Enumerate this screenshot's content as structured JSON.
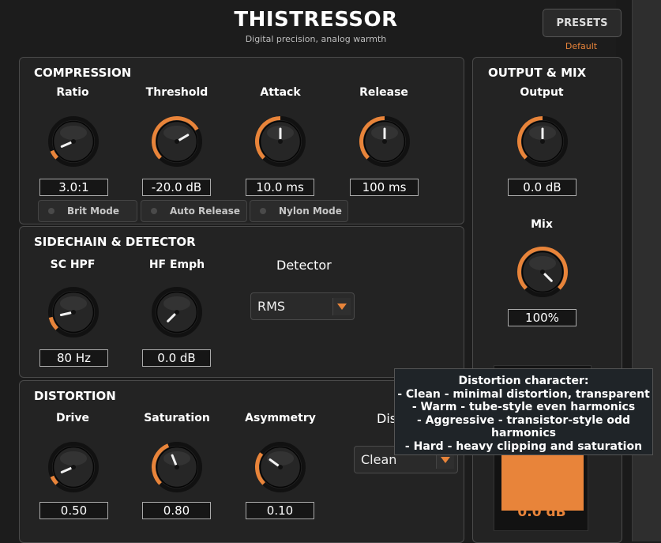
{
  "header": {
    "title": "THISTRESSOR",
    "subtitle": "Digital precision, analog warmth",
    "presets_label": "PRESETS",
    "preset_name": "Default"
  },
  "compression": {
    "title": "COMPRESSION",
    "knobs": [
      {
        "label": "Ratio",
        "value": "3.0:1",
        "level": 0.08
      },
      {
        "label": "Threshold",
        "value": "-20.0 dB",
        "level": 0.72
      },
      {
        "label": "Attack",
        "value": "10.0 ms",
        "level": 0.5
      },
      {
        "label": "Release",
        "value": "100 ms",
        "level": 0.5
      }
    ],
    "toggles": [
      {
        "label": "Brit Mode",
        "on": false
      },
      {
        "label": "Auto Release",
        "on": false
      },
      {
        "label": "Nylon Mode",
        "on": false
      }
    ]
  },
  "sidechain": {
    "title": "SIDECHAIN & DETECTOR",
    "knobs": [
      {
        "label": "SC HPF",
        "value": "80 Hz",
        "level": 0.12
      },
      {
        "label": "HF Emph",
        "value": "0.0 dB",
        "level": 0.0
      }
    ],
    "detector_label": "Detector",
    "detector_value": "RMS"
  },
  "distortion": {
    "title": "DISTORTION",
    "knobs": [
      {
        "label": "Drive",
        "value": "0.50",
        "level": 0.08
      },
      {
        "label": "Saturation",
        "value": "0.80",
        "level": 0.42
      },
      {
        "label": "Asymmetry",
        "value": "0.10",
        "level": 0.3
      }
    ],
    "type_label_partial": "Dis",
    "type_value": "Clean"
  },
  "output": {
    "title": "OUTPUT & MIX",
    "knobs": [
      {
        "label": "Output",
        "value": "0.0 dB",
        "level": 0.5
      },
      {
        "label": "Mix",
        "value": "100%",
        "level": 1.0
      }
    ],
    "meter_value": "0.0 dB"
  },
  "tooltip": {
    "lines": [
      "Distortion character:",
      "- Clean - minimal distortion, transparent",
      "- Warm - tube-style even harmonics",
      "- Aggressive - transistor-style odd",
      "harmonics",
      "- Hard - heavy clipping and saturation"
    ]
  },
  "colors": {
    "accent": "#e8843a",
    "panel": "#232323",
    "background": "#1c1c1c",
    "tooltip_bg": "#1f2428"
  },
  "icons": {
    "dropdown": "chevron-down-icon",
    "toggle_led": "led-indicator-icon"
  }
}
